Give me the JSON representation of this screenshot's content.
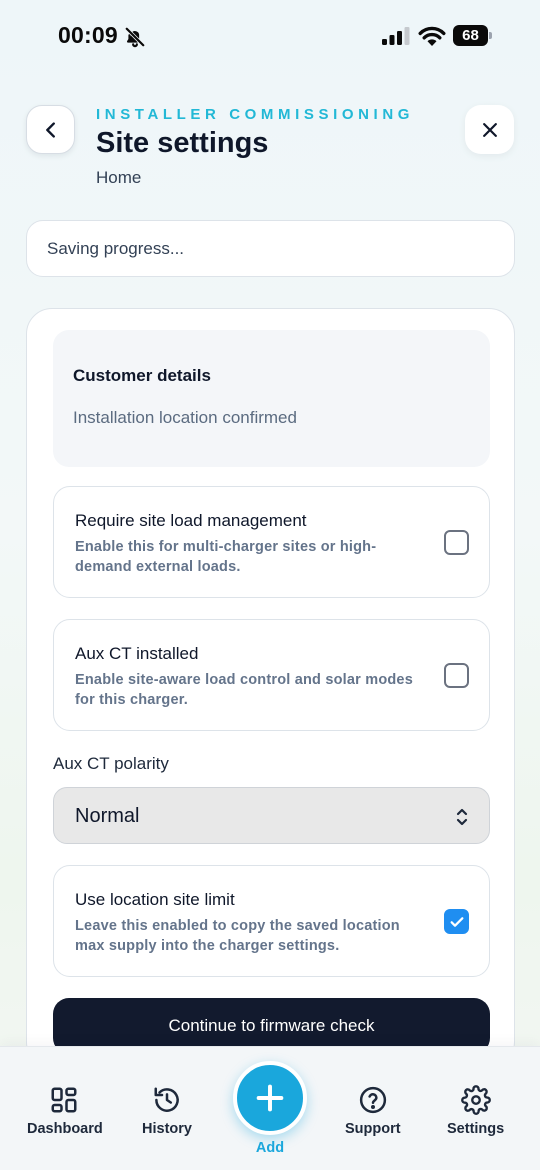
{
  "status_bar": {
    "time": "00:09",
    "battery": "68"
  },
  "header": {
    "eyebrow": "INSTALLER COMMISSIONING",
    "title": "Site settings",
    "subtitle": "Home"
  },
  "progress": {
    "text": "Saving progress..."
  },
  "customer": {
    "title": "Customer details",
    "subtitle": "Installation location confirmed"
  },
  "options": [
    {
      "title": "Require site load management",
      "description": "Enable this for multi-charger sites or high-demand external loads.",
      "checked": false
    },
    {
      "title": "Aux CT installed",
      "description": "Enable site-aware load control and solar modes for this charger.",
      "checked": false
    },
    {
      "title": "Use location site limit",
      "description": "Leave this enabled to copy the saved location max supply into the charger settings.",
      "checked": true
    }
  ],
  "polarity": {
    "label": "Aux CT polarity",
    "value": "Normal"
  },
  "continue_label": "Continue to firmware check",
  "nav": {
    "dashboard": "Dashboard",
    "history": "History",
    "add": "Add",
    "support": "Support",
    "settings": "Settings"
  },
  "colors": {
    "accent": "#1aa7dc",
    "eyebrow": "#22b8d6",
    "primary_button": "#121a2e",
    "checkbox_checked": "#1f8ef1"
  }
}
